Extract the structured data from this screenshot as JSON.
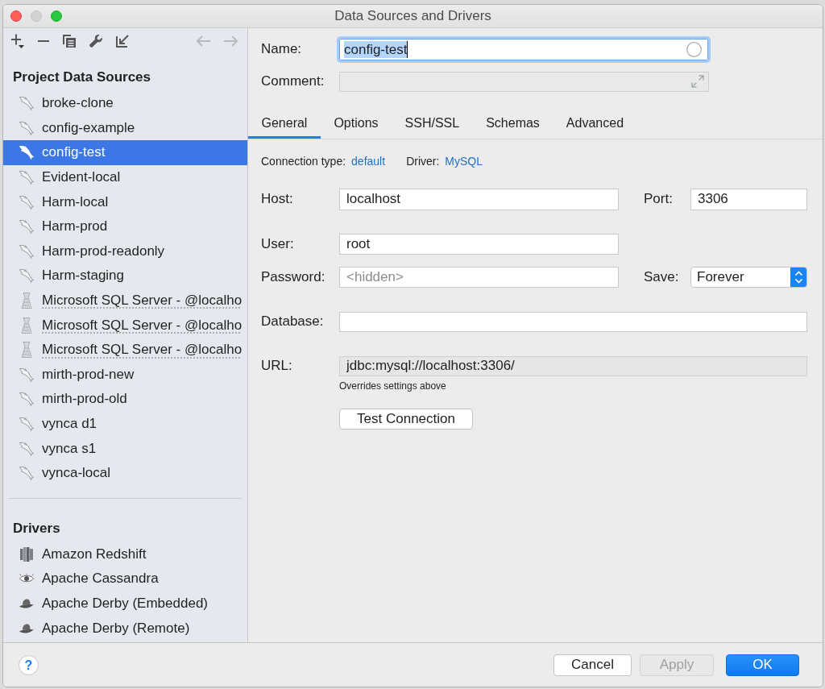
{
  "window": {
    "title": "Data Sources and Drivers",
    "minimize_disabled": true
  },
  "toolbar": {
    "back": {
      "disabled": true
    },
    "forward": {
      "disabled": true
    }
  },
  "project_data_sources": {
    "heading": "Project Data Sources",
    "items": [
      {
        "label": "broke-clone",
        "kind": "mysql",
        "selected": false,
        "warning": false
      },
      {
        "label": "config-example",
        "kind": "mysql",
        "selected": false,
        "warning": false
      },
      {
        "label": "config-test",
        "kind": "mysql",
        "selected": true,
        "warning": false
      },
      {
        "label": "Evident-local",
        "kind": "mysql",
        "selected": false,
        "warning": false
      },
      {
        "label": "Harm-local",
        "kind": "mysql",
        "selected": false,
        "warning": false
      },
      {
        "label": "Harm-prod",
        "kind": "mysql",
        "selected": false,
        "warning": false
      },
      {
        "label": "Harm-prod-readonly",
        "kind": "mysql",
        "selected": false,
        "warning": false
      },
      {
        "label": "Harm-staging",
        "kind": "mysql",
        "selected": false,
        "warning": false
      },
      {
        "label": "Microsoft SQL Server - @localho",
        "kind": "mssql",
        "selected": false,
        "warning": true
      },
      {
        "label": "Microsoft SQL Server - @localho",
        "kind": "mssql",
        "selected": false,
        "warning": true
      },
      {
        "label": "Microsoft SQL Server - @localho",
        "kind": "mssql",
        "selected": false,
        "warning": true
      },
      {
        "label": "mirth-prod-new",
        "kind": "mysql",
        "selected": false,
        "warning": false
      },
      {
        "label": "mirth-prod-old",
        "kind": "mysql",
        "selected": false,
        "warning": false
      },
      {
        "label": "vynca d1",
        "kind": "mysql",
        "selected": false,
        "warning": false
      },
      {
        "label": "vynca s1",
        "kind": "mysql",
        "selected": false,
        "warning": false
      },
      {
        "label": "vynca-local",
        "kind": "mysql",
        "selected": false,
        "warning": false
      }
    ]
  },
  "drivers": {
    "heading": "Drivers",
    "items": [
      {
        "label": "Amazon Redshift",
        "kind": "redshift",
        "selected": false
      },
      {
        "label": "Apache Cassandra",
        "kind": "cassandra",
        "selected": false
      },
      {
        "label": "Apache Derby (Embedded)",
        "kind": "derby",
        "selected": false
      },
      {
        "label": "Apache Derby (Remote)",
        "kind": "derby",
        "selected": false
      }
    ]
  },
  "name": {
    "label": "Name:",
    "value": "config-test",
    "focused": true,
    "text_selected": true
  },
  "comment": {
    "label": "Comment:",
    "disabled": true
  },
  "tabs": [
    {
      "label": "General",
      "selected": true
    },
    {
      "label": "Options",
      "selected": false
    },
    {
      "label": "SSH/SSL",
      "selected": false
    },
    {
      "label": "Schemas",
      "selected": false
    },
    {
      "label": "Advanced",
      "selected": false
    }
  ],
  "connection": {
    "type_label": "Connection type:",
    "type_value": "default",
    "driver_label": "Driver:",
    "driver_value": "MySQL"
  },
  "host": {
    "label": "Host:",
    "value": "localhost"
  },
  "port": {
    "label": "Port:",
    "value": "3306"
  },
  "user": {
    "label": "User:",
    "value": "root"
  },
  "password": {
    "label": "Password:",
    "placeholder": "<hidden>"
  },
  "save": {
    "label": "Save:",
    "value": "Forever"
  },
  "database": {
    "label": "Database:"
  },
  "url": {
    "label": "URL:",
    "value": "jdbc:mysql://localhost:3306/",
    "disabled": true,
    "hint": "Overrides settings above"
  },
  "test_connection_button": {
    "label": "Test Connection"
  },
  "footer": {
    "help": {
      "label": "?"
    },
    "buttons": [
      {
        "label": "Cancel",
        "disabled": false,
        "primary": false
      },
      {
        "label": "Apply",
        "disabled": true,
        "primary": false
      },
      {
        "label": "OK",
        "disabled": false,
        "primary": true
      }
    ]
  }
}
